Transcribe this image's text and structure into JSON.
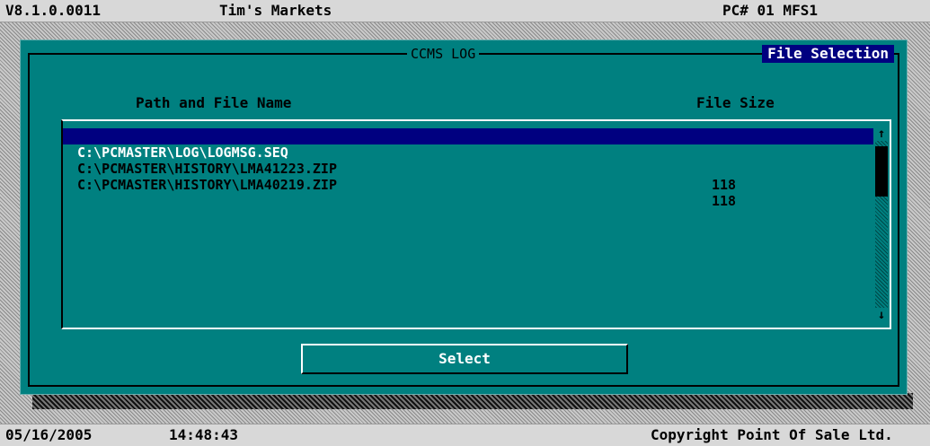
{
  "header": {
    "version": "V8.1.0.0011",
    "store_name": "Tim's Markets",
    "station": "PC# 01 MFS1"
  },
  "dialog": {
    "title": "CCMS LOG",
    "mode_label": "File Selection",
    "columns": {
      "path": "Path and File Name",
      "size": "File Size"
    },
    "files": [
      {
        "path": "C:\\PCMASTER\\LOG\\LOGMSG.SEQ",
        "size": ""
      },
      {
        "path": "C:\\PCMASTER\\HISTORY\\LMA41223.ZIP",
        "size": "118"
      },
      {
        "path": "C:\\PCMASTER\\HISTORY\\LMA40219.ZIP",
        "size": "118"
      }
    ],
    "selected_index": 0,
    "scroll_up_icon": "↑",
    "scroll_down_icon": "↓",
    "select_label": "Select"
  },
  "footer": {
    "date": "05/16/2005",
    "time": "14:48:43",
    "copyright": "Copyright Point Of Sale Ltd."
  },
  "colors": {
    "dialog_bg": "#008080",
    "selection_bg": "#000080",
    "bar_bg": "#d8d8d8"
  }
}
